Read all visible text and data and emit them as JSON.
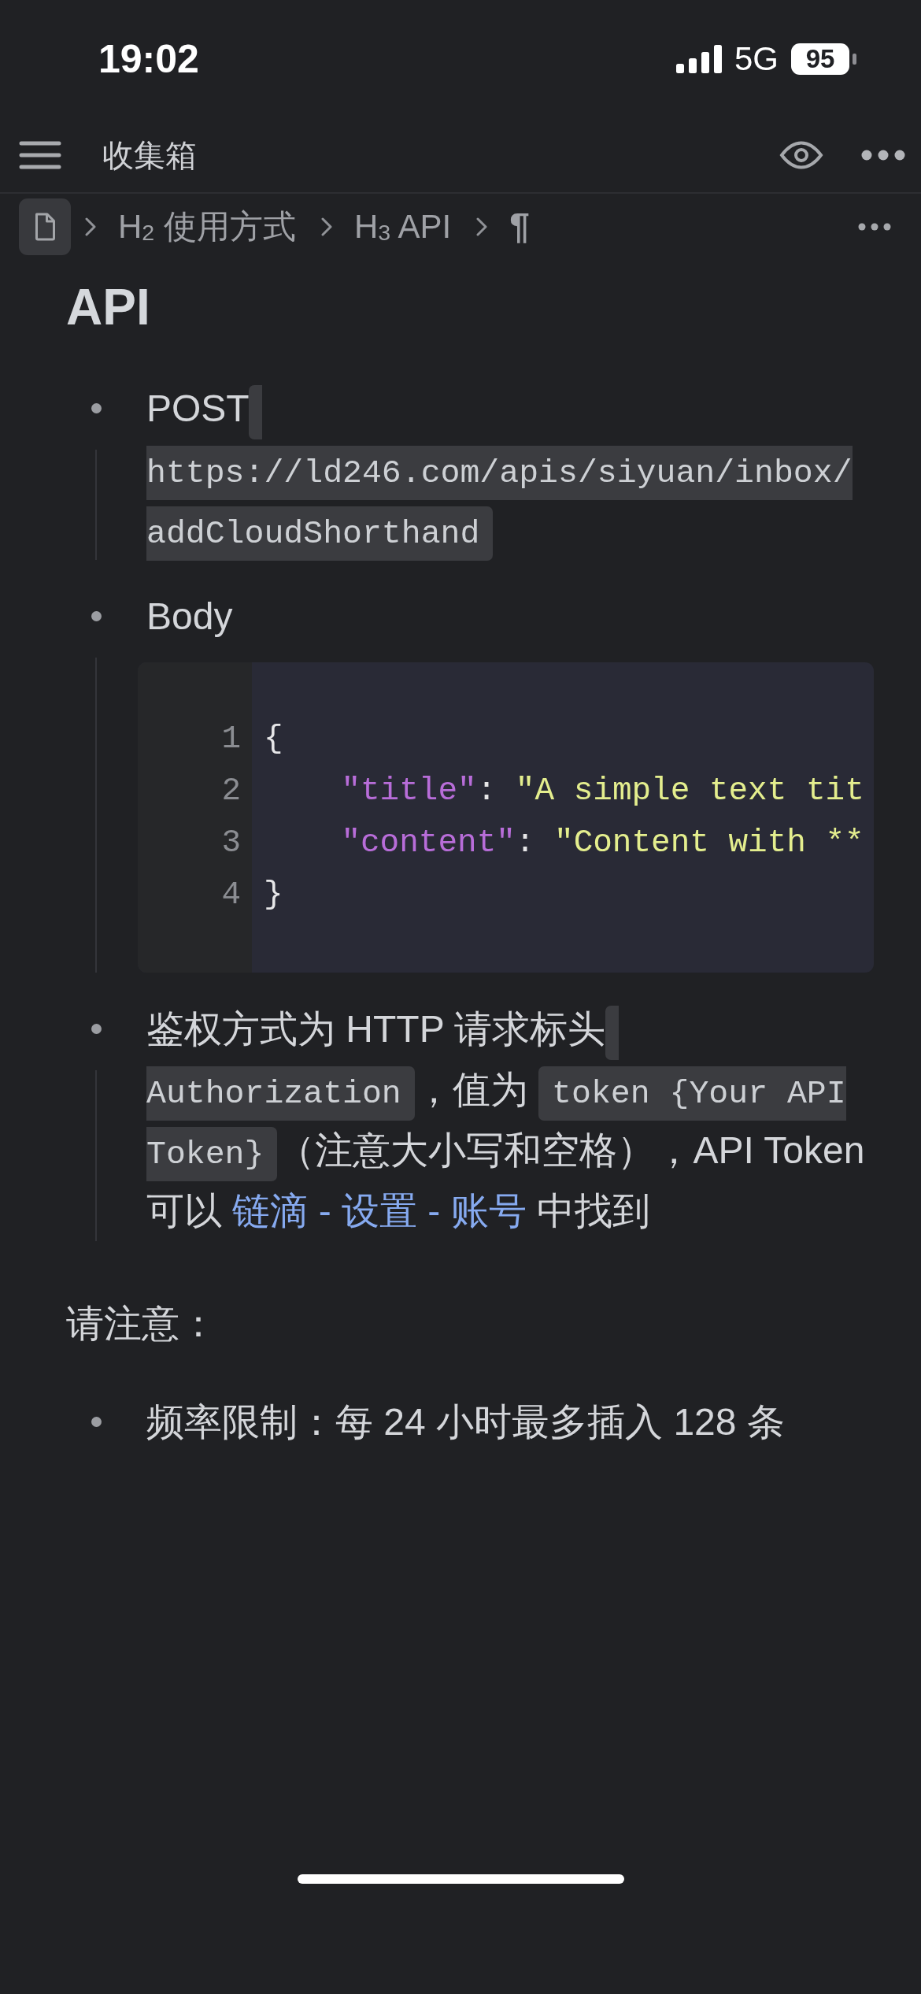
{
  "status_bar": {
    "time": "19:02",
    "network": "5G",
    "battery": "95"
  },
  "top_bar": {
    "title": "收集箱"
  },
  "breadcrumb": {
    "items": [
      {
        "kind": "heading",
        "text": "H$_{2}$ 使用方式"
      },
      {
        "kind": "heading",
        "text": "H$_{3}$ API"
      },
      {
        "kind": "paragraph",
        "text": "¶"
      }
    ]
  },
  "document": {
    "title": "API",
    "blocks": [
      {
        "kind": "list",
        "items": [
          {
            "runs": [
              {
                "kind": "text",
                "text": "POST "
              },
              {
                "kind": "code",
                "text": "https://ld246.com/apis/siyuan/inbox/addCloudShorthand"
              }
            ]
          },
          {
            "runs": [
              {
                "kind": "text",
                "text": "Body"
              }
            ],
            "code_block": {
              "lines": [
                {
                  "number": "1",
                  "indented": false,
                  "tokens": [
                    {
                      "kind": "punct",
                      "text": "{"
                    }
                  ]
                },
                {
                  "number": "2",
                  "indented": true,
                  "tokens": [
                    {
                      "kind": "key",
                      "text": "\"title\""
                    },
                    {
                      "kind": "punct",
                      "text": ": "
                    },
                    {
                      "kind": "string",
                      "text": "\"A simple text tit"
                    }
                  ]
                },
                {
                  "number": "3",
                  "indented": true,
                  "tokens": [
                    {
                      "kind": "key",
                      "text": "\"content\""
                    },
                    {
                      "kind": "punct",
                      "text": ": "
                    },
                    {
                      "kind": "string",
                      "text": "\"Content with **"
                    }
                  ]
                },
                {
                  "number": "4",
                  "indented": false,
                  "tokens": [
                    {
                      "kind": "punct",
                      "text": "}"
                    }
                  ]
                }
              ]
            }
          },
          {
            "runs": [
              {
                "kind": "text",
                "text": "鉴权方式为 HTTP 请求标头 "
              },
              {
                "kind": "code",
                "text": "Authorization"
              },
              {
                "kind": "text",
                "text": "，值为 "
              },
              {
                "kind": "code",
                "text": "token {Your API Token}"
              },
              {
                "kind": "text",
                "text": "（注意大小写和空格），API Token 可以 "
              },
              {
                "kind": "link",
                "text": "链滴 - 设置 - 账号"
              },
              {
                "kind": "text",
                "text": " 中找到"
              }
            ]
          }
        ]
      },
      {
        "kind": "paragraph",
        "runs": [
          {
            "kind": "text",
            "text": "请注意："
          }
        ]
      },
      {
        "kind": "list",
        "items": [
          {
            "runs": [
              {
                "kind": "text",
                "text": "频率限制：每 24 小时最多插入 128 条"
              }
            ]
          }
        ]
      }
    ]
  }
}
